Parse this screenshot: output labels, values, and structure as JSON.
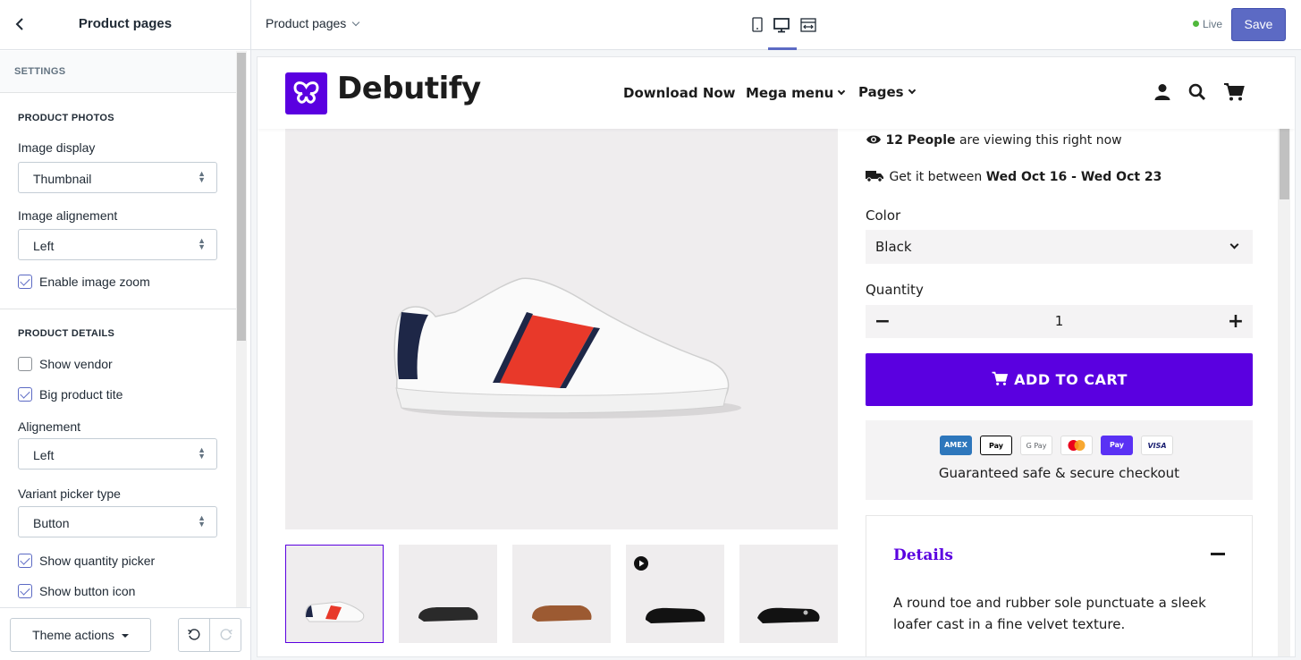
{
  "sidebar": {
    "title": "Product pages",
    "settings_label": "SETTINGS",
    "product_photos": {
      "title": "PRODUCT PHOTOS",
      "image_display_label": "Image display",
      "image_display_value": "Thumbnail",
      "image_alignment_label": "Image alignement",
      "image_alignment_value": "Left",
      "enable_zoom_label": "Enable image zoom",
      "enable_zoom_checked": true
    },
    "product_details": {
      "title": "PRODUCT DETAILS",
      "show_vendor_label": "Show vendor",
      "show_vendor_checked": false,
      "big_title_label": "Big product tite",
      "big_title_checked": true,
      "alignment_label": "Alignement",
      "alignment_value": "Left",
      "variant_picker_label": "Variant picker type",
      "variant_picker_value": "Button",
      "show_qty_label": "Show quantity picker",
      "show_qty_checked": true,
      "show_button_icon_label": "Show button icon",
      "show_button_icon_checked": true
    },
    "footer": {
      "theme_actions_label": "Theme actions"
    }
  },
  "topbar": {
    "page_select_label": "Product pages",
    "devices": [
      "mobile-icon",
      "desktop-icon",
      "fullscreen-icon"
    ],
    "active_device": "desktop",
    "live_label": "Live",
    "save_label": "Save"
  },
  "store": {
    "logo_text": "Debutify",
    "nav": [
      "Download Now",
      "Mega menu",
      "Pages"
    ],
    "header_icons": [
      "account-icon",
      "search-icon",
      "cart-icon"
    ],
    "viewing_count": "12 People",
    "viewing_suffix": "are viewing this right now",
    "delivery_prefix": "Get it between",
    "delivery_range": "Wed Oct 16 - Wed Oct 23",
    "color_label": "Color",
    "color_value": "Black",
    "quantity_label": "Quantity",
    "quantity_value": "1",
    "add_to_cart_label": "ADD TO CART",
    "payment_badges": [
      "AMEX",
      "Pay",
      "G Pay",
      "",
      "Pay",
      "VISA"
    ],
    "secure_text": "Guaranteed safe & secure checkout",
    "details_title": "Details",
    "details_text": "A round toe and rubber sole punctuate a sleek loafer cast in a fine velvet texture.",
    "brand_color": "#5a00e0"
  }
}
